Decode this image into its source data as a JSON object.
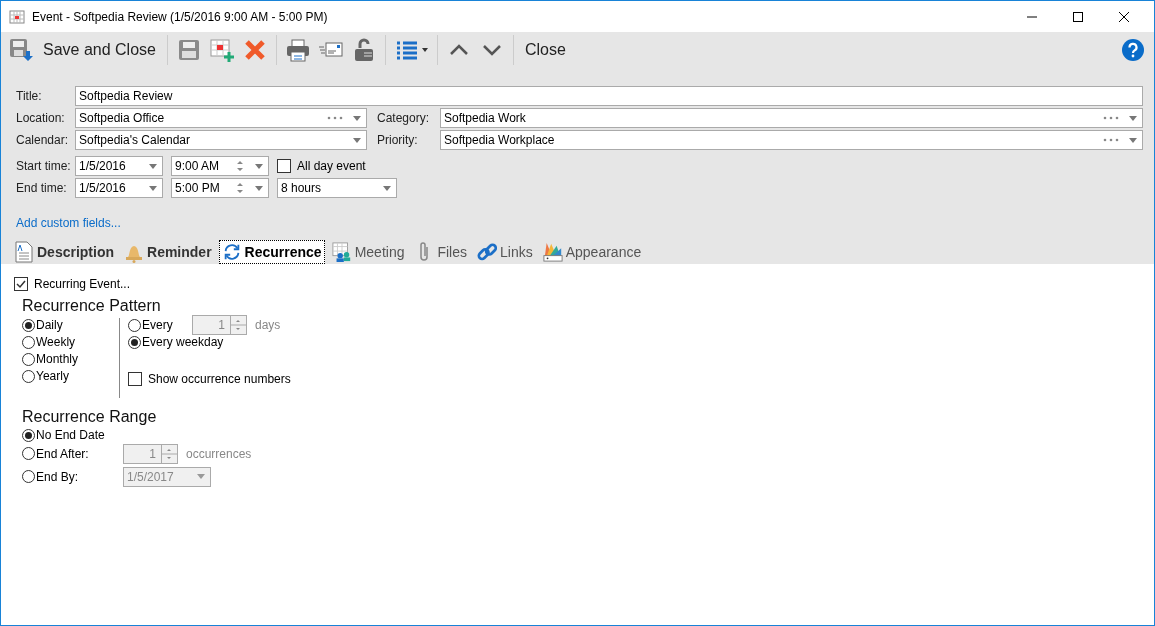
{
  "window": {
    "title": "Event - Softpedia Review (1/5/2016 9:00 AM - 5:00 PM)"
  },
  "toolbar": {
    "save_and_close": "Save and Close",
    "close": "Close"
  },
  "form": {
    "title_label": "Title:",
    "title": "Softpedia Review",
    "location_label": "Location:",
    "location": "Softpedia Office",
    "category_label": "Category:",
    "category": "Softpedia Work",
    "calendar_label": "Calendar:",
    "calendar": "Softpedia's Calendar",
    "priority_label": "Priority:",
    "priority": "Softpedia Workplace",
    "start_label": "Start time:",
    "start_date": "1/5/2016",
    "start_time": "9:00 AM",
    "all_day": {
      "label": "All day event",
      "checked": false
    },
    "end_label": "End time:",
    "end_date": "1/5/2016",
    "end_time": "5:00 PM",
    "duration": "8 hours",
    "custom_fields_link": "Add custom fields..."
  },
  "tabs": [
    {
      "label": "Description",
      "kind": "description",
      "emphasized": true,
      "selected": false
    },
    {
      "label": "Reminder",
      "kind": "reminder",
      "emphasized": true,
      "selected": false
    },
    {
      "label": "Recurrence",
      "kind": "recurrence",
      "emphasized": true,
      "selected": true
    },
    {
      "label": "Meeting",
      "kind": "meeting",
      "emphasized": false,
      "selected": false
    },
    {
      "label": "Files",
      "kind": "files",
      "emphasized": false,
      "selected": false
    },
    {
      "label": "Links",
      "kind": "links",
      "emphasized": false,
      "selected": false
    },
    {
      "label": "Appearance",
      "kind": "appearance",
      "emphasized": false,
      "selected": false
    }
  ],
  "recurring_event": {
    "label": "Recurring Event...",
    "checked": true
  },
  "pattern": {
    "heading": "Recurrence Pattern",
    "frequencies": [
      {
        "label": "Daily",
        "selected": true
      },
      {
        "label": "Weekly",
        "selected": false
      },
      {
        "label": "Monthly",
        "selected": false
      },
      {
        "label": "Yearly",
        "selected": false
      }
    ],
    "every": {
      "label": "Every",
      "selected": false,
      "value": "1",
      "unit": "days"
    },
    "every_weekday": {
      "label": "Every weekday",
      "selected": true
    },
    "show_numbers": {
      "label": "Show occurrence numbers",
      "checked": false
    }
  },
  "range": {
    "heading": "Recurrence Range",
    "no_end": {
      "label": "No End Date",
      "selected": true
    },
    "end_after": {
      "label": "End After:",
      "selected": false,
      "value": "1",
      "unit": "occurrences"
    },
    "end_by": {
      "label": "End By:",
      "selected": false,
      "date": "1/5/2017"
    }
  }
}
